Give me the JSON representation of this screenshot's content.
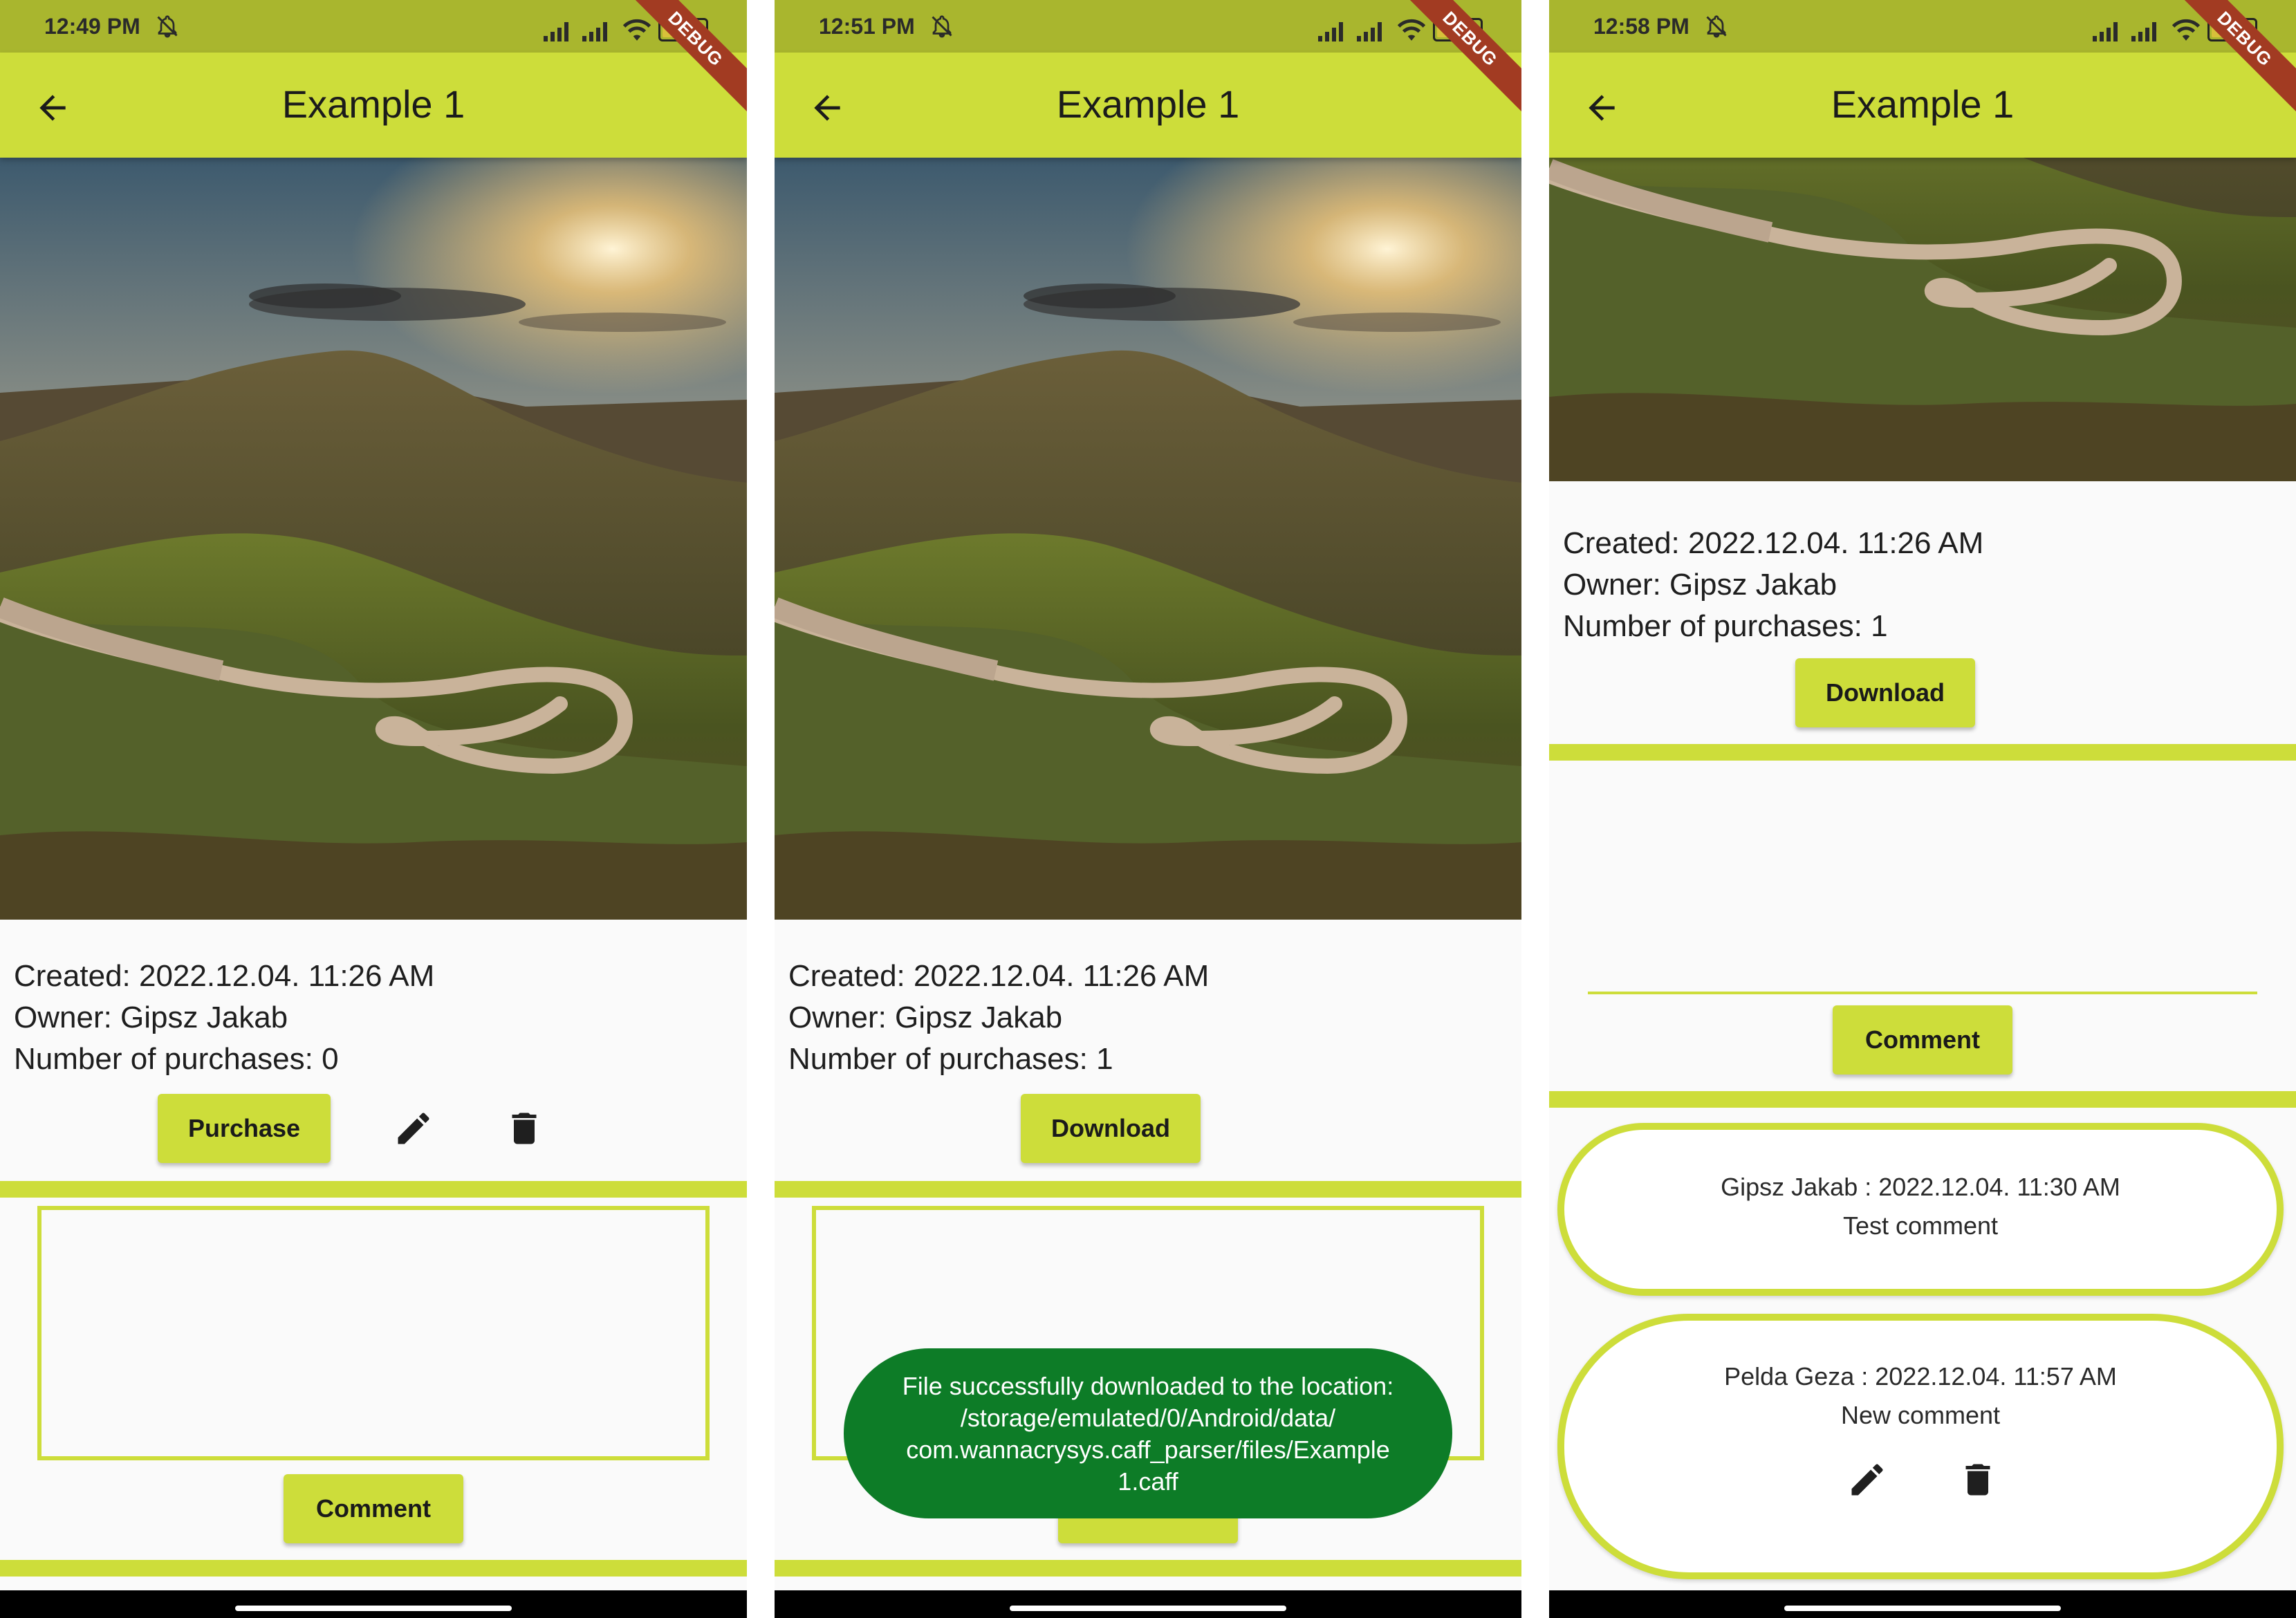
{
  "screens": [
    {
      "status_time": "12:49 PM",
      "battery": "96",
      "title": "Example 1",
      "debug_banner": "DEBUG",
      "info": {
        "created": "Created: 2022.12.04. 11:26 AM",
        "owner": "Owner: Gipsz Jakab",
        "purchases": "Number of purchases: 0"
      },
      "primary_button": "Purchase",
      "comment_button": "Comment"
    },
    {
      "status_time": "12:51 PM",
      "battery": "96",
      "title": "Example 1",
      "debug_banner": "DEBUG",
      "info": {
        "created": "Created: 2022.12.04. 11:26 AM",
        "owner": "Owner: Gipsz Jakab",
        "purchases": "Number of purchases: 1"
      },
      "primary_button": "Download",
      "comment_button": "Comment",
      "toast": [
        "File successfully downloaded to the location:",
        "/storage/emulated/0/Android/data/",
        "com.wannacrysys.caff_parser/files/Example",
        "1.caff"
      ]
    },
    {
      "status_time": "12:58 PM",
      "battery": "94",
      "title": "Example 1",
      "debug_banner": "DEBUG",
      "info": {
        "created": "Created: 2022.12.04. 11:26 AM",
        "owner": "Owner: Gipsz Jakab",
        "purchases": "Number of purchases: 1"
      },
      "primary_button": "Download",
      "comment_button": "Comment",
      "comments": [
        {
          "header": "Gipsz Jakab : 2022.12.04. 11:30 AM",
          "text": "Test comment"
        },
        {
          "header": "Pelda Geza : 2022.12.04. 11:57 AM",
          "text": "New comment"
        }
      ]
    }
  ],
  "colors": {
    "accent": "#cddd3a",
    "status_bar": "#a9b62e",
    "toast": "#0d7c27",
    "debug_banner": "#a23b22"
  },
  "icons": [
    "back-arrow-icon",
    "mute-icon",
    "signal-icon",
    "wifi-icon",
    "battery-icon",
    "edit-pencil-icon",
    "delete-trash-icon"
  ]
}
